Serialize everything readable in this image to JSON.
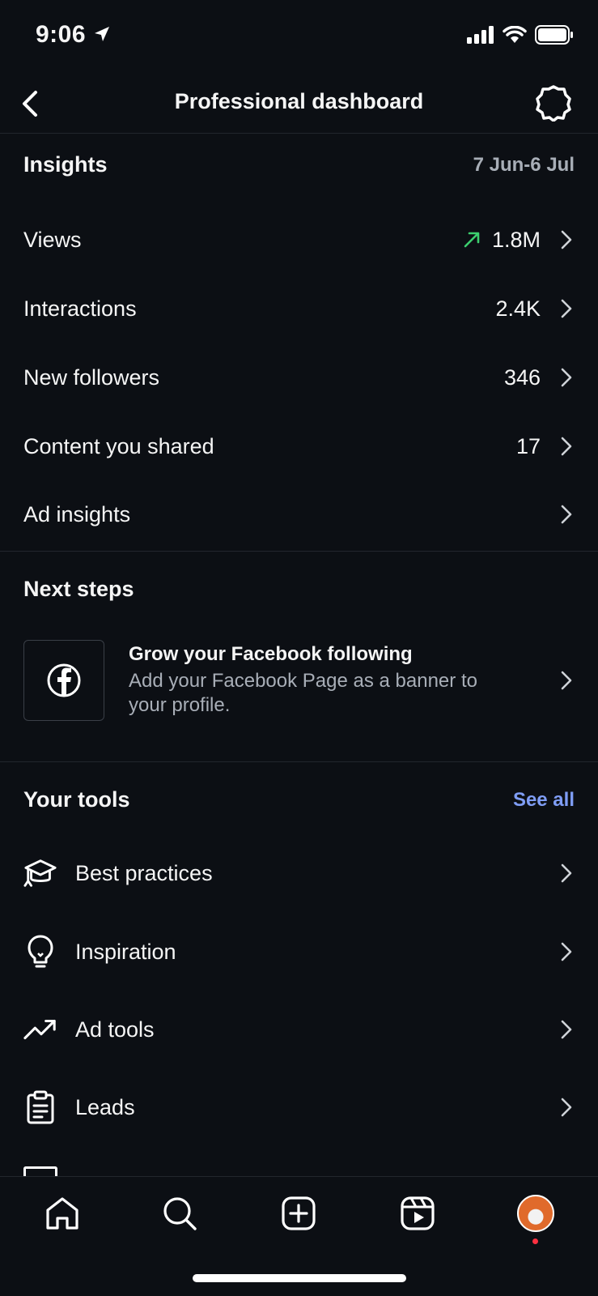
{
  "status_bar": {
    "time": "9:06"
  },
  "header": {
    "title": "Professional dashboard"
  },
  "insights": {
    "title": "Insights",
    "date_range": "7 Jun-6 Jul",
    "rows": [
      {
        "label": "Views",
        "value": "1.8M",
        "trend": "up"
      },
      {
        "label": "Interactions",
        "value": "2.4K"
      },
      {
        "label": "New followers",
        "value": "346"
      },
      {
        "label": "Content you shared",
        "value": "17"
      },
      {
        "label": "Ad insights",
        "value": ""
      }
    ]
  },
  "next_steps": {
    "title": "Next steps",
    "card": {
      "title": "Grow your Facebook following",
      "description": "Add your Facebook Page as a banner to your profile.",
      "icon": "facebook-icon"
    }
  },
  "tools": {
    "title": "Your tools",
    "see_all": "See all",
    "items": [
      {
        "label": "Best practices",
        "icon": "graduation-cap-icon"
      },
      {
        "label": "Inspiration",
        "icon": "lightbulb-icon"
      },
      {
        "label": "Ad tools",
        "icon": "trending-up-icon"
      },
      {
        "label": "Leads",
        "icon": "clipboard-icon"
      }
    ]
  },
  "bottom_nav": [
    "home-icon",
    "search-icon",
    "create-icon",
    "reels-icon",
    "profile-avatar"
  ],
  "colors": {
    "background": "#0c0f14",
    "accent": "#7f9df5",
    "trend_up": "#3ccf6e",
    "notification": "#ff3040"
  }
}
